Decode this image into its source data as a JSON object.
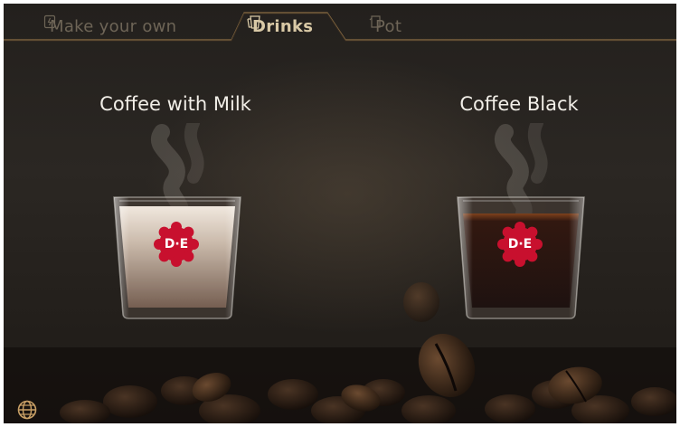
{
  "tabs": [
    {
      "label": "Make your own",
      "icon": "thermos-icon",
      "active": false
    },
    {
      "label": "Drinks",
      "icon": "cups-icon",
      "active": true
    },
    {
      "label": "Pot",
      "icon": "pot-icon",
      "active": false
    }
  ],
  "drinks": [
    {
      "name": "Coffee with Milk",
      "logo_text": "D·E",
      "icon": "milk-coffee-cup"
    },
    {
      "name": "Coffee Black",
      "logo_text": "D·E",
      "icon": "black-coffee-cup"
    }
  ],
  "footer": {
    "language_icon": "globe-icon"
  },
  "colors": {
    "accent": "#c9a066",
    "active_tab_text": "#d9c9a6",
    "inactive_tab_text": "#6e6557",
    "logo_red": "#c8102e",
    "background": "#26221e"
  }
}
